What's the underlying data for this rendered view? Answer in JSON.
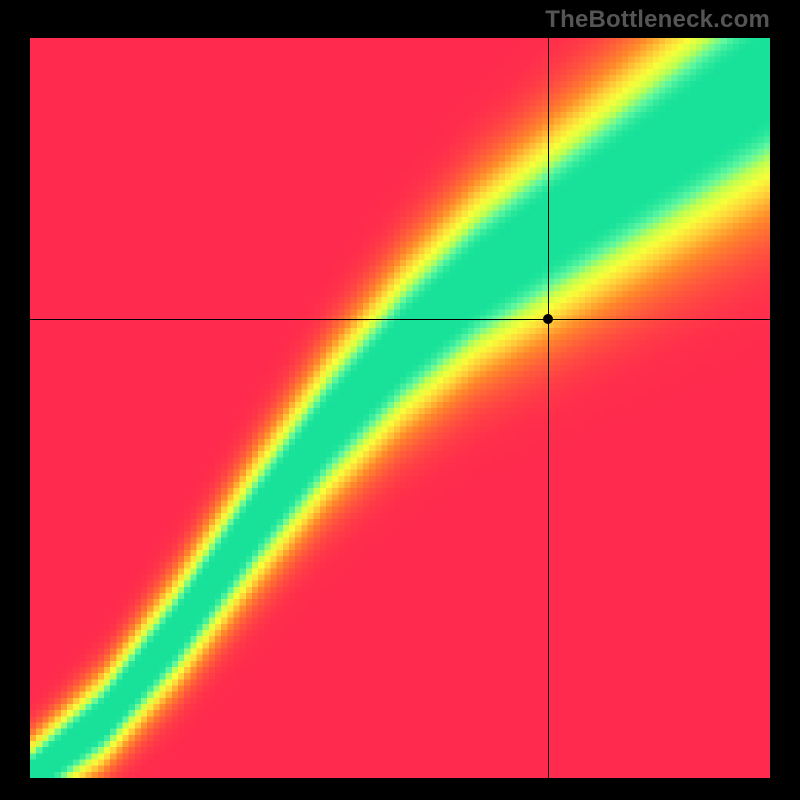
{
  "watermark": "TheBottleneck.com",
  "chart_data": {
    "type": "heatmap",
    "title": "",
    "xlabel": "",
    "ylabel": "",
    "xlim": [
      0,
      100
    ],
    "ylim": [
      0,
      100
    ],
    "grid_resolution": 120,
    "color_stops": [
      {
        "t": 0.0,
        "hex": "#ff2a4d"
      },
      {
        "t": 0.35,
        "hex": "#ff8a2a"
      },
      {
        "t": 0.55,
        "hex": "#ffd23a"
      },
      {
        "t": 0.7,
        "hex": "#f7ff3a"
      },
      {
        "t": 0.82,
        "hex": "#c2ff4e"
      },
      {
        "t": 0.92,
        "hex": "#5ff7a0"
      },
      {
        "t": 1.0,
        "hex": "#18e29a"
      }
    ],
    "ideal_curve": {
      "description": "Diagonal optimal-match ridge with slight S-bend (maps x→y where value is highest).",
      "samples": [
        {
          "x": 0,
          "y": 0
        },
        {
          "x": 10,
          "y": 8
        },
        {
          "x": 20,
          "y": 20
        },
        {
          "x": 30,
          "y": 34
        },
        {
          "x": 40,
          "y": 47
        },
        {
          "x": 50,
          "y": 58
        },
        {
          "x": 60,
          "y": 67
        },
        {
          "x": 70,
          "y": 74
        },
        {
          "x": 80,
          "y": 81
        },
        {
          "x": 90,
          "y": 88
        },
        {
          "x": 100,
          "y": 95
        }
      ],
      "band_half_width": 6.0
    },
    "crosshair": {
      "x": 70,
      "y": 62
    },
    "marker": {
      "x": 70,
      "y": 62
    }
  }
}
